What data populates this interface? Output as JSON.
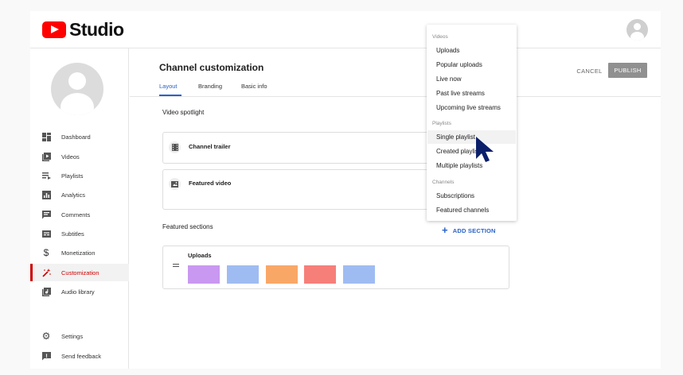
{
  "app": {
    "name": "Studio"
  },
  "sidebar": {
    "items": [
      {
        "label": "Dashboard",
        "icon": "dashboard-icon"
      },
      {
        "label": "Videos",
        "icon": "videos-icon"
      },
      {
        "label": "Playlists",
        "icon": "playlists-icon"
      },
      {
        "label": "Analytics",
        "icon": "analytics-icon"
      },
      {
        "label": "Comments",
        "icon": "comments-icon"
      },
      {
        "label": "Subtitles",
        "icon": "subtitles-icon"
      },
      {
        "label": "Monetization",
        "icon": "dollar-icon",
        "glyph": "$"
      },
      {
        "label": "Customization",
        "icon": "magic-wand-icon",
        "active": true
      },
      {
        "label": "Audio library",
        "icon": "audio-library-icon"
      }
    ],
    "bottom": [
      {
        "label": "Settings",
        "icon": "gear-icon",
        "glyph": "⚙"
      },
      {
        "label": "Send feedback",
        "icon": "feedback-icon",
        "glyph": "!"
      }
    ]
  },
  "main": {
    "title": "Channel customization",
    "tabs": [
      {
        "label": "Layout",
        "active": true
      },
      {
        "label": "Branding"
      },
      {
        "label": "Basic info"
      }
    ],
    "actions": {
      "cancel": "CANCEL",
      "publish": "PUBLISH"
    },
    "video_spotlight": {
      "title": "Video spotlight",
      "channel_trailer": "Channel trailer",
      "featured_video": "Featured video"
    },
    "featured_sections": {
      "title": "Featured sections",
      "add_section": "ADD SECTION",
      "uploads": {
        "label": "Uploads",
        "thumb_colors": [
          "#c998f0",
          "#9fbcf2",
          "#f9a767",
          "#f77f7a",
          "#9fbcf2"
        ]
      }
    }
  },
  "menu": {
    "groups": [
      {
        "header": "Videos",
        "items": [
          "Uploads",
          "Popular uploads",
          "Live now",
          "Past live streams",
          "Upcoming live streams"
        ]
      },
      {
        "header": "Playlists",
        "items": [
          "Single playlist",
          "Created playlists",
          "Multiple playlists"
        ]
      },
      {
        "header": "Channels",
        "items": [
          "Subscriptions",
          "Featured channels"
        ]
      }
    ],
    "hovered": "Single playlist"
  },
  "colors": {
    "accent": "#2962c9",
    "brand": "#ff0000",
    "active_nav": "#cc0000",
    "cursor": "#0b1f6b"
  }
}
